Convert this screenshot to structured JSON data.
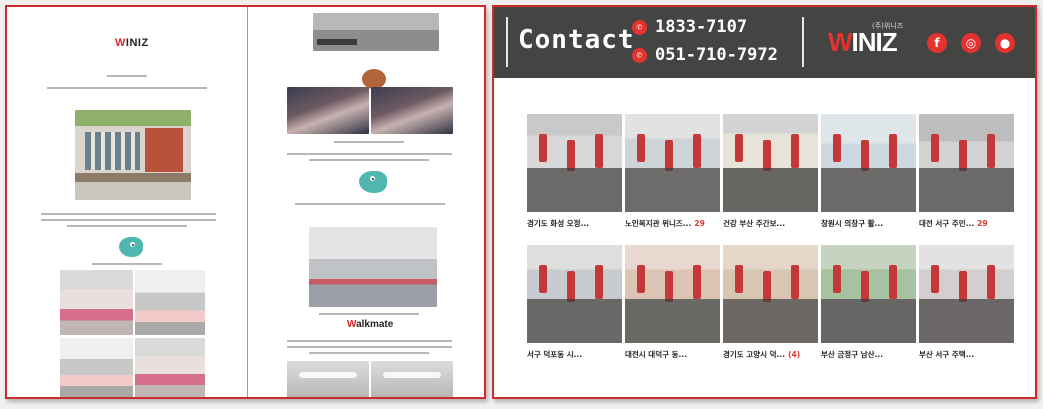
{
  "left_doc": {
    "logo": {
      "w": "W",
      "rest": "INIZ"
    },
    "walk_logo": {
      "w": "W",
      "rest": "alkmate"
    }
  },
  "contact": {
    "title": "Contact",
    "phones": [
      "1833-7107",
      "051-710-7972"
    ],
    "phone_icon": "phone-icon",
    "brand_small": "(주)위니즈",
    "brand": {
      "w": "W",
      "rest": "INIZ"
    },
    "social": [
      {
        "name": "facebook-icon",
        "glyph": "f"
      },
      {
        "name": "instagram-icon",
        "glyph": "◎"
      },
      {
        "name": "chat-icon",
        "glyph": "●"
      }
    ],
    "accent": "#e4332e",
    "bar_color": "#444443"
  },
  "gallery": [
    {
      "overlay": [
        "",
        ""
      ],
      "title": "경기도 화성 오정...",
      "date": "",
      "badge": ""
    },
    {
      "overlay": [
        "",
        ""
      ],
      "title": "노인복지관 위니즈...",
      "date": "",
      "badge": "29"
    },
    {
      "overlay": [
        "",
        ""
      ],
      "title": "건강 부산 주간보...",
      "date": "",
      "badge": ""
    },
    {
      "overlay": [
        "",
        ""
      ],
      "title": "창원시 의창구 활...",
      "date": "",
      "badge": ""
    },
    {
      "overlay": [
        "",
        ""
      ],
      "title": "대전 서구 주민...",
      "date": "",
      "badge": "29"
    },
    {
      "overlay": [
        "",
        ""
      ],
      "title": "서구 덕포동 시...",
      "date": "",
      "badge": ""
    },
    {
      "overlay": [
        "",
        ""
      ],
      "title": "대전시 대덕구 동...",
      "date": "",
      "badge": ""
    },
    {
      "overlay": [
        "",
        ""
      ],
      "title": "경기도 고양시 덕...",
      "date": "",
      "badge": "(4)"
    },
    {
      "overlay": [
        "",
        ""
      ],
      "title": "부산 금정구 남산...",
      "date": "",
      "badge": ""
    },
    {
      "overlay": [
        "",
        ""
      ],
      "title": "부산 서구 주택...",
      "date": "",
      "badge": ""
    }
  ]
}
